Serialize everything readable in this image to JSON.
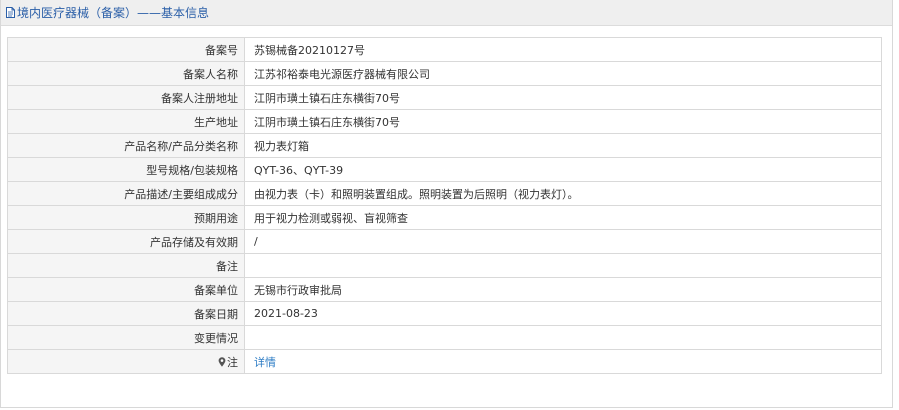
{
  "header": {
    "title": "境内医疗器械（备案）——基本信息",
    "icon": "document-icon"
  },
  "rows": [
    {
      "label": "备案号",
      "value": "苏锡械备20210127号"
    },
    {
      "label": "备案人名称",
      "value": "江苏祁裕泰电光源医疗器械有限公司"
    },
    {
      "label": "备案人注册地址",
      "value": "江阴市璜土镇石庄东横街70号"
    },
    {
      "label": "生产地址",
      "value": "江阴市璜土镇石庄东横街70号"
    },
    {
      "label": "产品名称/产品分类名称",
      "value": "视力表灯箱"
    },
    {
      "label": "型号规格/包装规格",
      "value": "QYT-36、QYT-39"
    },
    {
      "label": "产品描述/主要组成成分",
      "value": "由视力表（卡）和照明装置组成。照明装置为后照明（视力表灯）。"
    },
    {
      "label": "预期用途",
      "value": "用于视力检测或弱视、盲视筛查"
    },
    {
      "label": "产品存储及有效期",
      "value": "/"
    },
    {
      "label": "备注",
      "value": ""
    },
    {
      "label": "备案单位",
      "value": "无锡市行政审批局"
    },
    {
      "label": "备案日期",
      "value": "2021-08-23"
    },
    {
      "label": "变更情况",
      "value": ""
    },
    {
      "label": "注",
      "value": "详情",
      "icon": "pin-icon"
    }
  ],
  "colors": {
    "title": "#2b5fa8",
    "link": "#2b7bc4",
    "label_bg": "#f5f5f5",
    "border": "#d9d9d9"
  }
}
